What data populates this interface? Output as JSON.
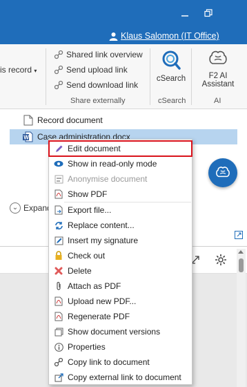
{
  "titlebar": {
    "minimize_icon": "minimize-icon",
    "restore_icon": "restore-icon",
    "user_name": "Klaus Salomon (IT Office)"
  },
  "ribbon": {
    "left_partial_label": "is record",
    "share_items": [
      {
        "label": "Shared link overview",
        "icon": "link-icon"
      },
      {
        "label": "Send upload link",
        "icon": "link-icon"
      },
      {
        "label": "Send download link",
        "icon": "link-icon"
      }
    ],
    "share_group_label": "Share externally",
    "csearch_label": "cSearch",
    "csearch_group_label": "cSearch",
    "ai_label_line1": "F2 AI",
    "ai_label_line2": "Assistant",
    "ai_group_label": "AI"
  },
  "list": {
    "row1": "Record document",
    "row2": "Case administration.docx",
    "expand_label": "Expand"
  },
  "context_menu": {
    "items": [
      {
        "label": "Edit document",
        "icon": "pencil-icon",
        "enabled": true,
        "highlighted": true
      },
      {
        "label": "Show in read-only mode",
        "icon": "eye-icon",
        "enabled": true
      },
      {
        "label": "Anonymise document",
        "icon": "anonymise-icon",
        "enabled": false
      },
      {
        "label": "Show PDF",
        "icon": "pdf-icon",
        "enabled": true
      },
      {
        "label": "Export file...",
        "icon": "export-icon",
        "enabled": true
      },
      {
        "label": "Replace content...",
        "icon": "replace-icon",
        "enabled": true
      },
      {
        "label": "Insert my signature",
        "icon": "signature-icon",
        "enabled": true
      },
      {
        "label": "Check out",
        "icon": "lock-icon",
        "enabled": true
      },
      {
        "label": "Delete",
        "icon": "delete-icon",
        "enabled": true
      },
      {
        "label": "Attach as PDF",
        "icon": "paperclip-icon",
        "enabled": true
      },
      {
        "label": "Upload new PDF...",
        "icon": "pdf-icon",
        "enabled": true
      },
      {
        "label": "Regenerate PDF",
        "icon": "pdf-icon",
        "enabled": true
      },
      {
        "label": "Show document versions",
        "icon": "versions-icon",
        "enabled": true
      },
      {
        "label": "Properties",
        "icon": "info-icon",
        "enabled": true
      },
      {
        "label": "Copy link to document",
        "icon": "copy-link-icon",
        "enabled": true
      },
      {
        "label": "Copy external link to document",
        "icon": "external-link-icon",
        "enabled": true
      }
    ]
  },
  "colors": {
    "brand_blue": "#1f6dba",
    "selection": "#b7d4ef",
    "highlight_red": "#d9121b"
  }
}
